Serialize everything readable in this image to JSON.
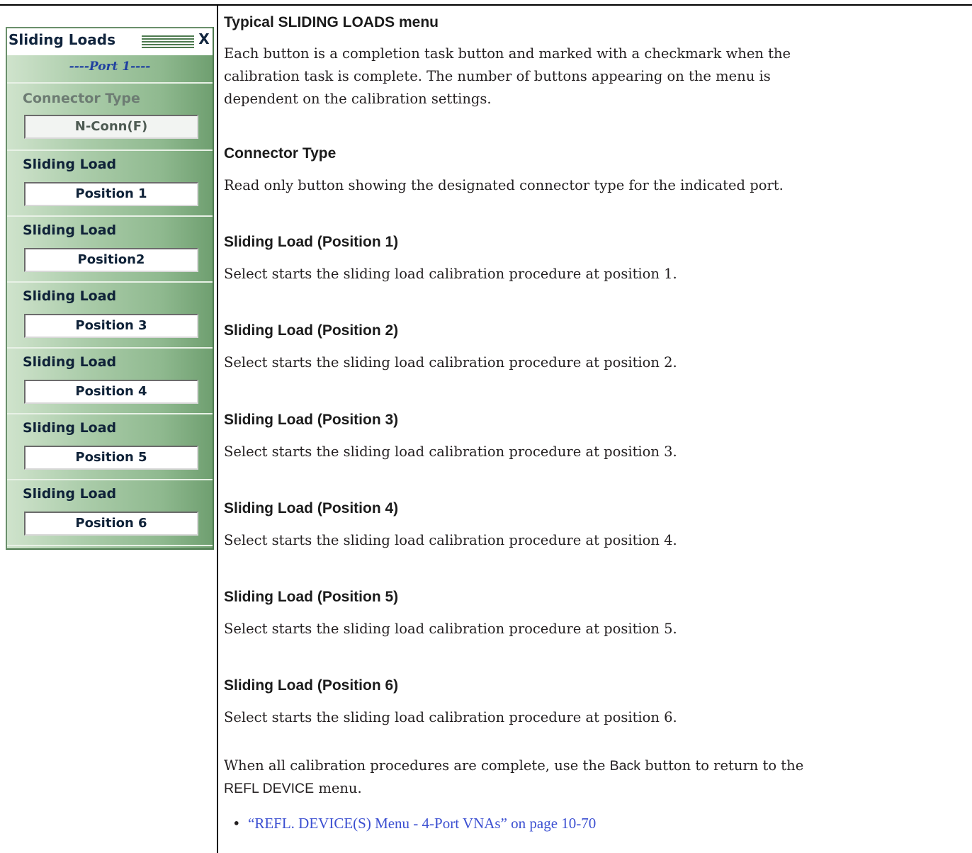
{
  "menu": {
    "title": "Sliding Loads",
    "close": "X",
    "port": "----Port 1----",
    "connector": {
      "label": "Connector Type",
      "value": "N-Conn(F)"
    },
    "items": [
      {
        "label": "Sliding Load",
        "button": "Position 1"
      },
      {
        "label": "Sliding Load",
        "button": "Position2"
      },
      {
        "label": "Sliding Load",
        "button": "Position 3"
      },
      {
        "label": "Sliding Load",
        "button": "Position 4"
      },
      {
        "label": "Sliding Load",
        "button": "Position 5"
      },
      {
        "label": "Sliding Load",
        "button": "Position 6"
      }
    ]
  },
  "doc": {
    "caption": "Typical SLIDING LOADS menu",
    "intro_line1": "Each button is a completion task button and marked with a checkmark when the",
    "intro_line2": "calibration task is complete. The number of buttons appearing on the menu is",
    "intro_line3": "dependent on the calibration settings.",
    "sections": [
      {
        "heading": "Connector Type",
        "text": "Read only button showing the designated connector type for the indicated port."
      },
      {
        "heading": "Sliding Load (Position 1)",
        "text": "Select starts the sliding load calibration procedure at position 1."
      },
      {
        "heading": "Sliding Load (Position 2)",
        "text": "Select starts the sliding load calibration procedure at position 2."
      },
      {
        "heading": "Sliding Load (Position 3)",
        "text": "Select starts the sliding load calibration procedure at position 3."
      },
      {
        "heading": "Sliding Load (Position 4)",
        "text": "Select starts the sliding load calibration procedure at position 4."
      },
      {
        "heading": "Sliding Load (Position 5)",
        "text": "Select starts the sliding load calibration procedure at position 5."
      },
      {
        "heading": "Sliding Load (Position 6)",
        "text": "Select starts the sliding load calibration procedure at position 6."
      }
    ],
    "outro_part1": "When all calibration procedures are complete, use the ",
    "outro_back": "Back",
    "outro_part2": " button to return to the",
    "outro_line2": "REFL DEVICE",
    "outro_line2_tail": " menu.",
    "bullet_symbol": "•",
    "link_text": "“REFL. DEVICE(S) Menu - 4-Port VNAs” on page 10-70"
  }
}
